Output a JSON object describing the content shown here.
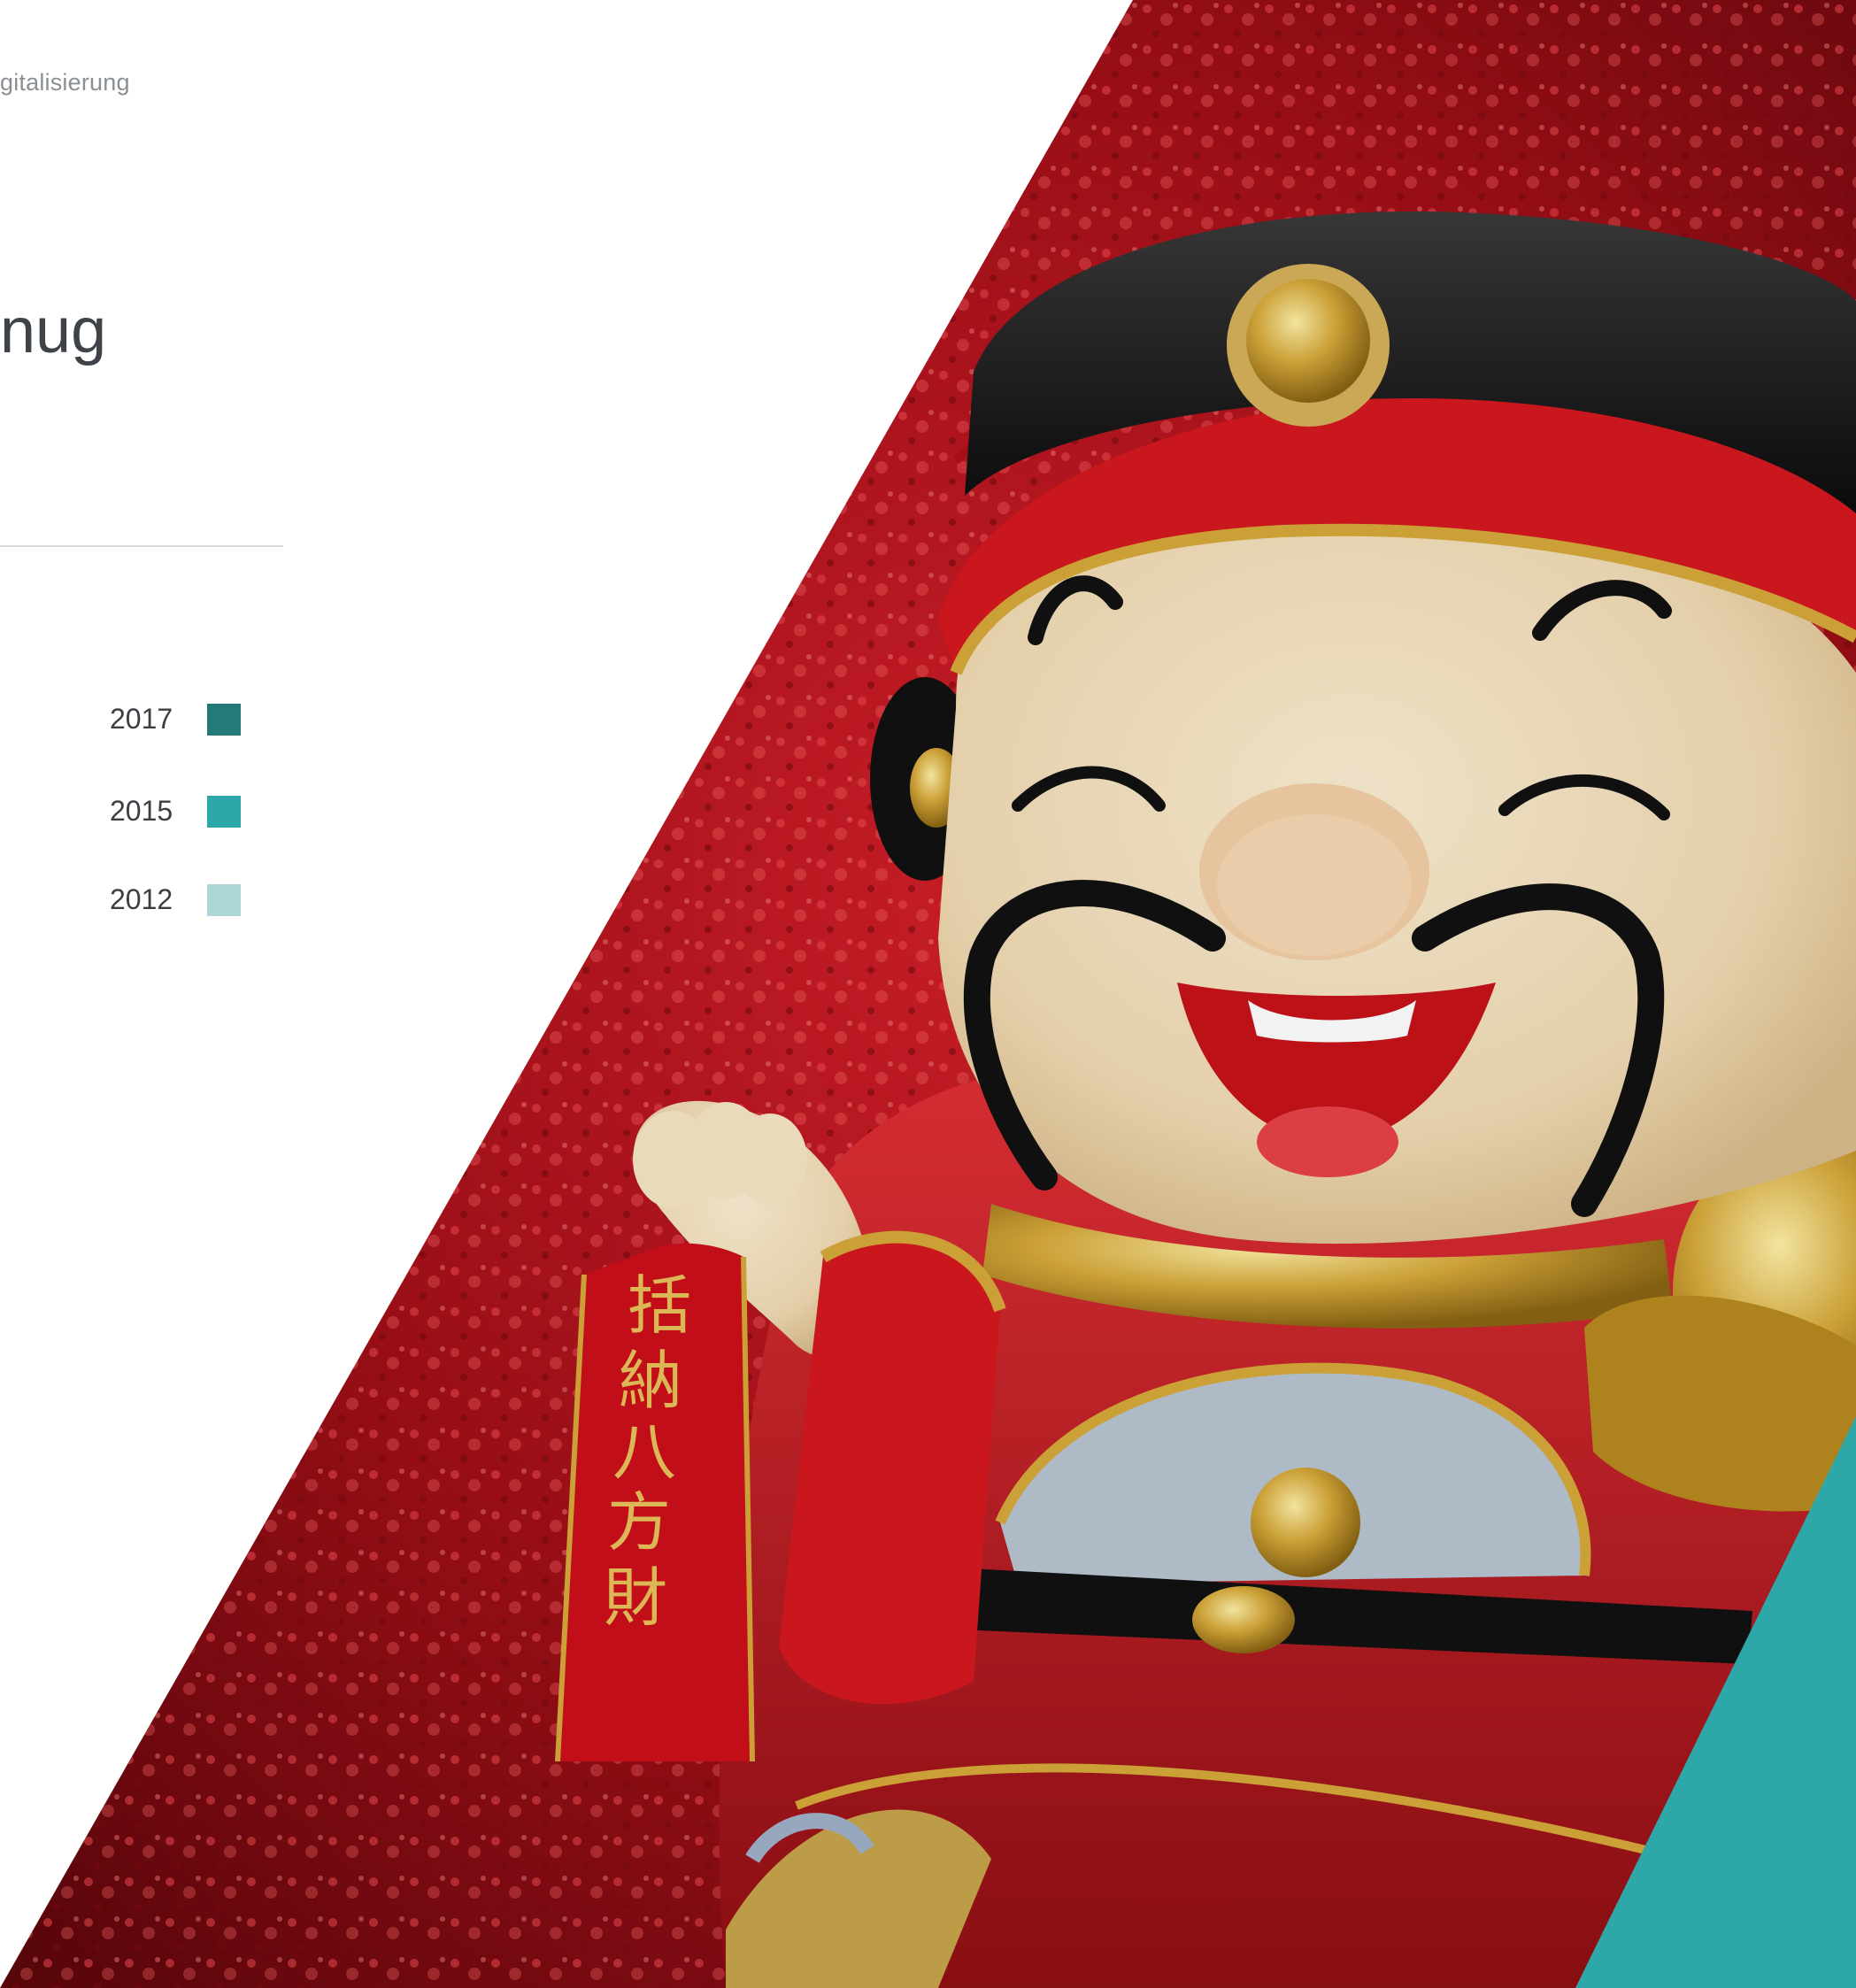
{
  "breadcrumb": "gitalisierung",
  "title": "nug",
  "legend": {
    "items": [
      {
        "label": "2017",
        "color": "#237a78"
      },
      {
        "label": "2015",
        "color": "#2ea7a8"
      },
      {
        "label": "2012",
        "color": "#acd5d7"
      }
    ]
  },
  "banner": {
    "chars": [
      "括",
      "納",
      "八",
      "方",
      "財"
    ]
  },
  "colors": {
    "accent": "#2ea7a8",
    "background_red": "#b3121b"
  }
}
